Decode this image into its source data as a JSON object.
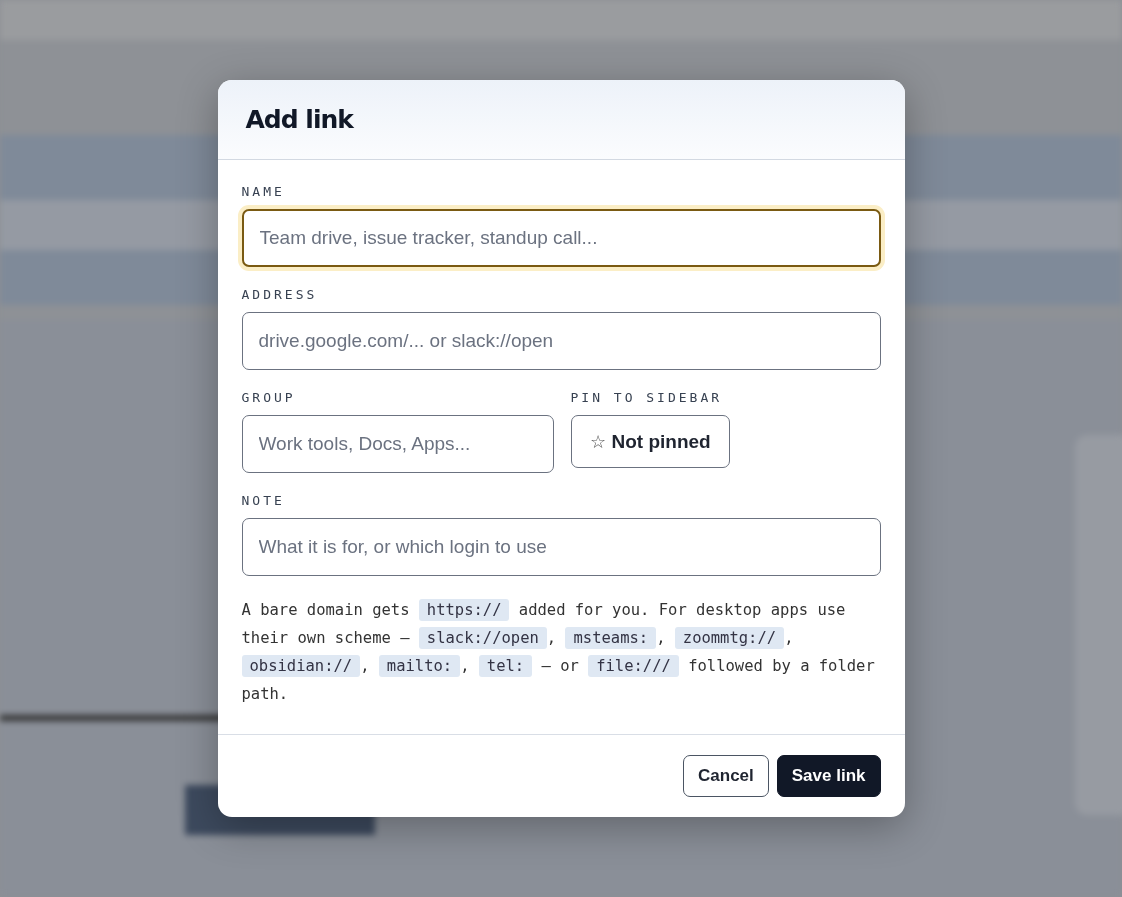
{
  "dialog": {
    "title": "Add link",
    "fields": [
      {
        "kind": "text",
        "label": "NAME",
        "placeholder": "Team drive, issue tracker, standup call...",
        "focused": true
      },
      {
        "kind": "text",
        "label": "ADDRESS",
        "placeholder": "drive.google.com/... or slack://open",
        "focused": false
      },
      {
        "kind": "text",
        "label": "GROUP",
        "placeholder": "Work tools, Docs, Apps...",
        "focused": false
      },
      {
        "kind": "toggle",
        "label": "PIN TO SIDEBAR",
        "icon": "☆",
        "value": "Not pinned",
        "pinned": false
      },
      {
        "kind": "text",
        "label": "NOTE",
        "placeholder": "What it is for, or which login to use",
        "focused": false
      }
    ],
    "hint": [
      {
        "kind": "plain",
        "text": "A bare domain gets "
      },
      {
        "kind": "code",
        "text": "https://"
      },
      {
        "kind": "plain",
        "text": " added for you. For desktop apps use their own scheme — "
      },
      {
        "kind": "code",
        "text": "slack://open"
      },
      {
        "kind": "plain",
        "text": ", "
      },
      {
        "kind": "code",
        "text": "msteams:"
      },
      {
        "kind": "plain",
        "text": ", "
      },
      {
        "kind": "code",
        "text": "zoommtg://"
      },
      {
        "kind": "plain",
        "text": ", "
      },
      {
        "kind": "code",
        "text": "obsidian://"
      },
      {
        "kind": "plain",
        "text": ", "
      },
      {
        "kind": "code",
        "text": "mailto:"
      },
      {
        "kind": "plain",
        "text": ", "
      },
      {
        "kind": "code",
        "text": "tel:"
      },
      {
        "kind": "plain",
        "text": " — or "
      },
      {
        "kind": "code",
        "text": "file:///"
      },
      {
        "kind": "plain",
        "text": " followed by a folder path."
      }
    ],
    "buttons": [
      {
        "kind": "secondary",
        "label": "Cancel"
      },
      {
        "kind": "primary",
        "label": "Save link"
      }
    ]
  }
}
